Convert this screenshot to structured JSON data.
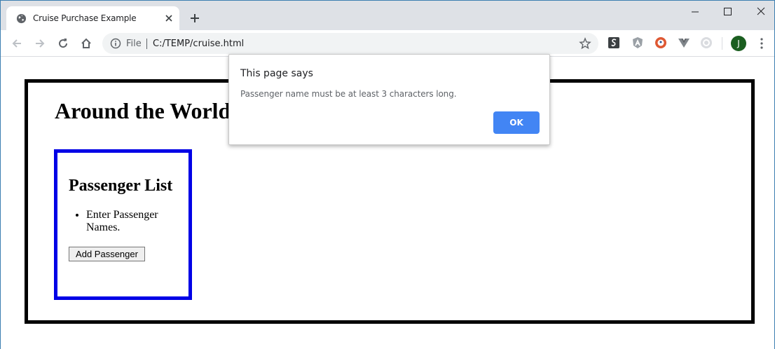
{
  "browser": {
    "tab": {
      "title": "Cruise Purchase Example"
    },
    "address_bar": {
      "scheme_label": "File",
      "url": "C:/TEMP/cruise.html"
    },
    "profile_initial": "J",
    "colors": {
      "tabstrip": "#dee1e6",
      "omnibox": "#f1f3f4",
      "avatar": "#1b5e20"
    },
    "icons": [
      "globe-icon",
      "close-icon",
      "plus-icon",
      "minimize-icon",
      "maximize-icon",
      "back-icon",
      "forward-icon",
      "reload-icon",
      "home-icon",
      "info-icon",
      "star-icon",
      "kebab-menu-icon"
    ]
  },
  "page": {
    "title": "Around the World",
    "passenger_panel": {
      "heading": "Passenger List",
      "items": [
        "Enter Passenger Names."
      ],
      "add_button_label": "Add Passenger"
    },
    "colors": {
      "outer_border": "#000000",
      "panel_border": "#0000e6"
    }
  },
  "dialog": {
    "title": "This page says",
    "message": "Passenger name must be at least 3 characters long.",
    "ok_label": "OK",
    "ok_color": "#4285f4"
  }
}
